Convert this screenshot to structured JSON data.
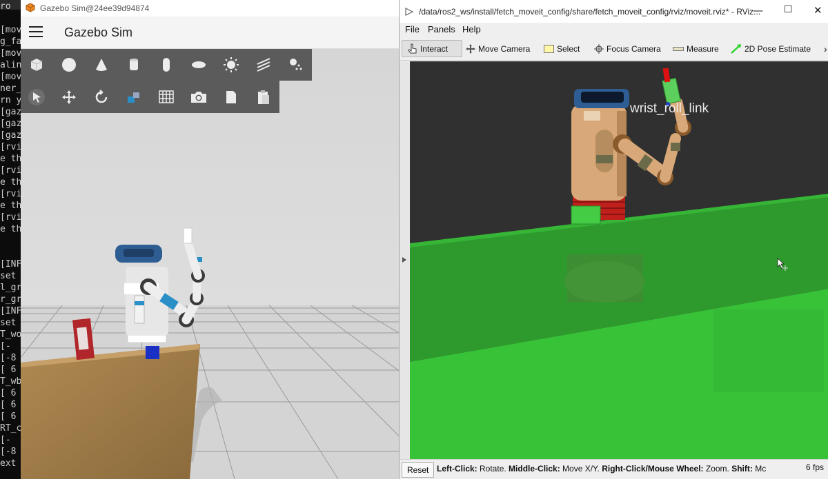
{
  "terminal": {
    "lines": [
      "ro",
      "",
      "[mov",
      "g_fa",
      "[mov",
      "alin",
      "[mov",
      "ner_",
      "rn y",
      "[gaz",
      "[gaz",
      "[gaz",
      "[rvi",
      "e th",
      "[rvi",
      "e th",
      "[rvi",
      "e th",
      "[rvi",
      "e th",
      "",
      "",
      "[INF",
      "set",
      "l_gr",
      "r_gr",
      "[INF",
      "set",
      "T_wo",
      "[-",
      "[-8",
      "[ 6",
      "T_wb",
      "[ 6",
      "[ 6",
      "[ 6",
      "RT_c",
      "[-",
      "[-8",
      "ext"
    ]
  },
  "gazebo": {
    "window_title": "Gazebo Sim@24ee39d94874",
    "app_title": "Gazebo Sim",
    "shape_tools": [
      "box-icon",
      "sphere-icon",
      "cone-icon",
      "cylinder-icon",
      "capsule-icon",
      "ellipsoid-icon",
      "point-light-icon",
      "directional-light-icon",
      "spot-light-icon"
    ],
    "transform_tools": [
      "select-icon",
      "translate-icon",
      "rotate-icon",
      "scale-icon",
      "grid-snap-icon",
      "screenshot-icon",
      "copy-icon",
      "paste-icon"
    ]
  },
  "rviz": {
    "window_title": "/data/ros2_ws/install/fetch_moveit_config/share/fetch_moveit_config/rviz/moveit.rviz* - RViz...",
    "menus": [
      "File",
      "Panels",
      "Help"
    ],
    "tools": [
      {
        "label": "Interact",
        "icon": "hand-cursor-icon",
        "active": true
      },
      {
        "label": "Move Camera",
        "icon": "move-camera-icon",
        "active": false
      },
      {
        "label": "Select",
        "icon": "select-box-icon",
        "active": false
      },
      {
        "label": "Focus Camera",
        "icon": "focus-camera-icon",
        "active": false
      },
      {
        "label": "Measure",
        "icon": "ruler-icon",
        "active": false
      },
      {
        "label": "2D Pose Estimate",
        "icon": "pose-arrow-icon",
        "active": false
      }
    ],
    "overflow": "›",
    "view_label": "wrist_roll_link",
    "status": {
      "reset": "Reset",
      "hint_parts": [
        {
          "b": "Left-Click:",
          "t": " Rotate. "
        },
        {
          "b": "Middle-Click:",
          "t": " Move X/Y. "
        },
        {
          "b": "Right-Click/Mouse Wheel:",
          "t": " Zoom. "
        },
        {
          "b": "Shift:",
          "t": " Mc"
        }
      ],
      "fps": "6 fps"
    }
  },
  "colors": {
    "gazebo_toolbar": "#5b5b5b",
    "rviz_background": "#303030",
    "rviz_plane_green": "#37c237",
    "robot_skin": "#d8a878",
    "fetch_blue": "#2a8fc7",
    "robot_head_blue": "#2e5d93"
  }
}
